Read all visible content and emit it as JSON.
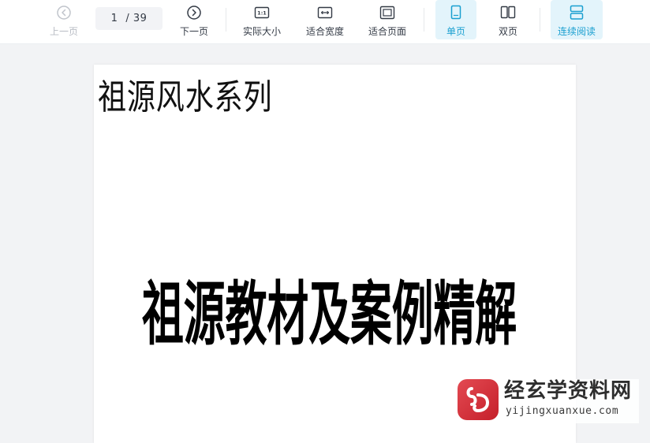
{
  "toolbar": {
    "prev_label": "上一页",
    "page_current": "1",
    "page_total": "/ 39",
    "next_label": "下一页",
    "actual_size_label": "实际大小",
    "fit_width_label": "适合宽度",
    "fit_page_label": "适合页面",
    "single_page_label": "单页",
    "double_page_label": "双页",
    "continuous_label": "连续阅读",
    "actual_size_icon_text": "1:1"
  },
  "document": {
    "series_title": "祖源风水系列",
    "main_title": "祖源教材及案例精解"
  },
  "watermark": {
    "name": "经玄学资料网",
    "url": "yijingxuanxue.com"
  },
  "colors": {
    "accent": "#1a9fd0",
    "active_bg": "#e3f4fb",
    "disabled": "#b8bcc4",
    "logo_red": "#d0303a"
  }
}
